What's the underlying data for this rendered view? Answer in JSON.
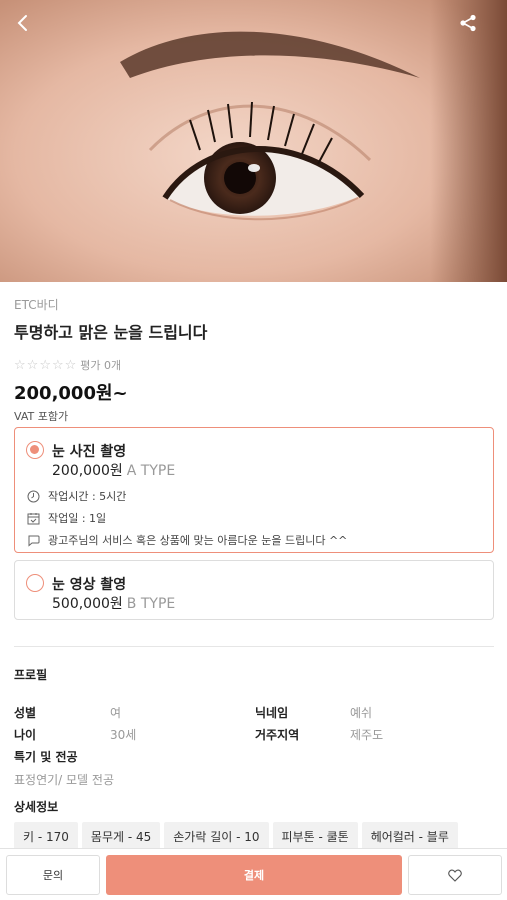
{
  "header": {
    "back_icon": "chevron-left-icon",
    "share_icon": "share-icon"
  },
  "product": {
    "category": "ETC바디",
    "title": "투명하고 맑은 눈을 드립니다",
    "rating_stars": 0,
    "rating_text": "평가 0개",
    "price": "200,000원~",
    "vat": "VAT 포함가"
  },
  "options": [
    {
      "name": "눈 사진 촬영",
      "price": "200,000원",
      "type": "A TYPE",
      "selected": true,
      "work_time": "작업시간 : 5시간",
      "work_days": "작업일 : 1일",
      "description": "광고주님의 서비스 혹은 상품에 맞는 아름다운 눈을 드립니다 ^^"
    },
    {
      "name": "눈 영상 촬영",
      "price": "500,000원",
      "type": "B TYPE",
      "selected": false
    }
  ],
  "profile": {
    "section_title": "프로필",
    "gender_label": "성별",
    "gender_value": "여",
    "nickname_label": "닉네임",
    "nickname_value": "예쉬",
    "age_label": "나이",
    "age_value": "30세",
    "region_label": "거주지역",
    "region_value": "제주도",
    "specialty_label": "특기 및 전공",
    "specialty_value": "표정연기/ 모델 전공",
    "details_title": "상세정보",
    "tags": [
      "키 - 170",
      "몸무게 - 45",
      "손가락 길이 - 10",
      "피부톤 - 쿨톤",
      "헤어컬러 - 블루"
    ]
  },
  "actions": {
    "inquiry_label": "문의",
    "pay_label": "결제",
    "like_icon": "heart-icon"
  },
  "colors": {
    "accent": "#ee8f7a"
  }
}
